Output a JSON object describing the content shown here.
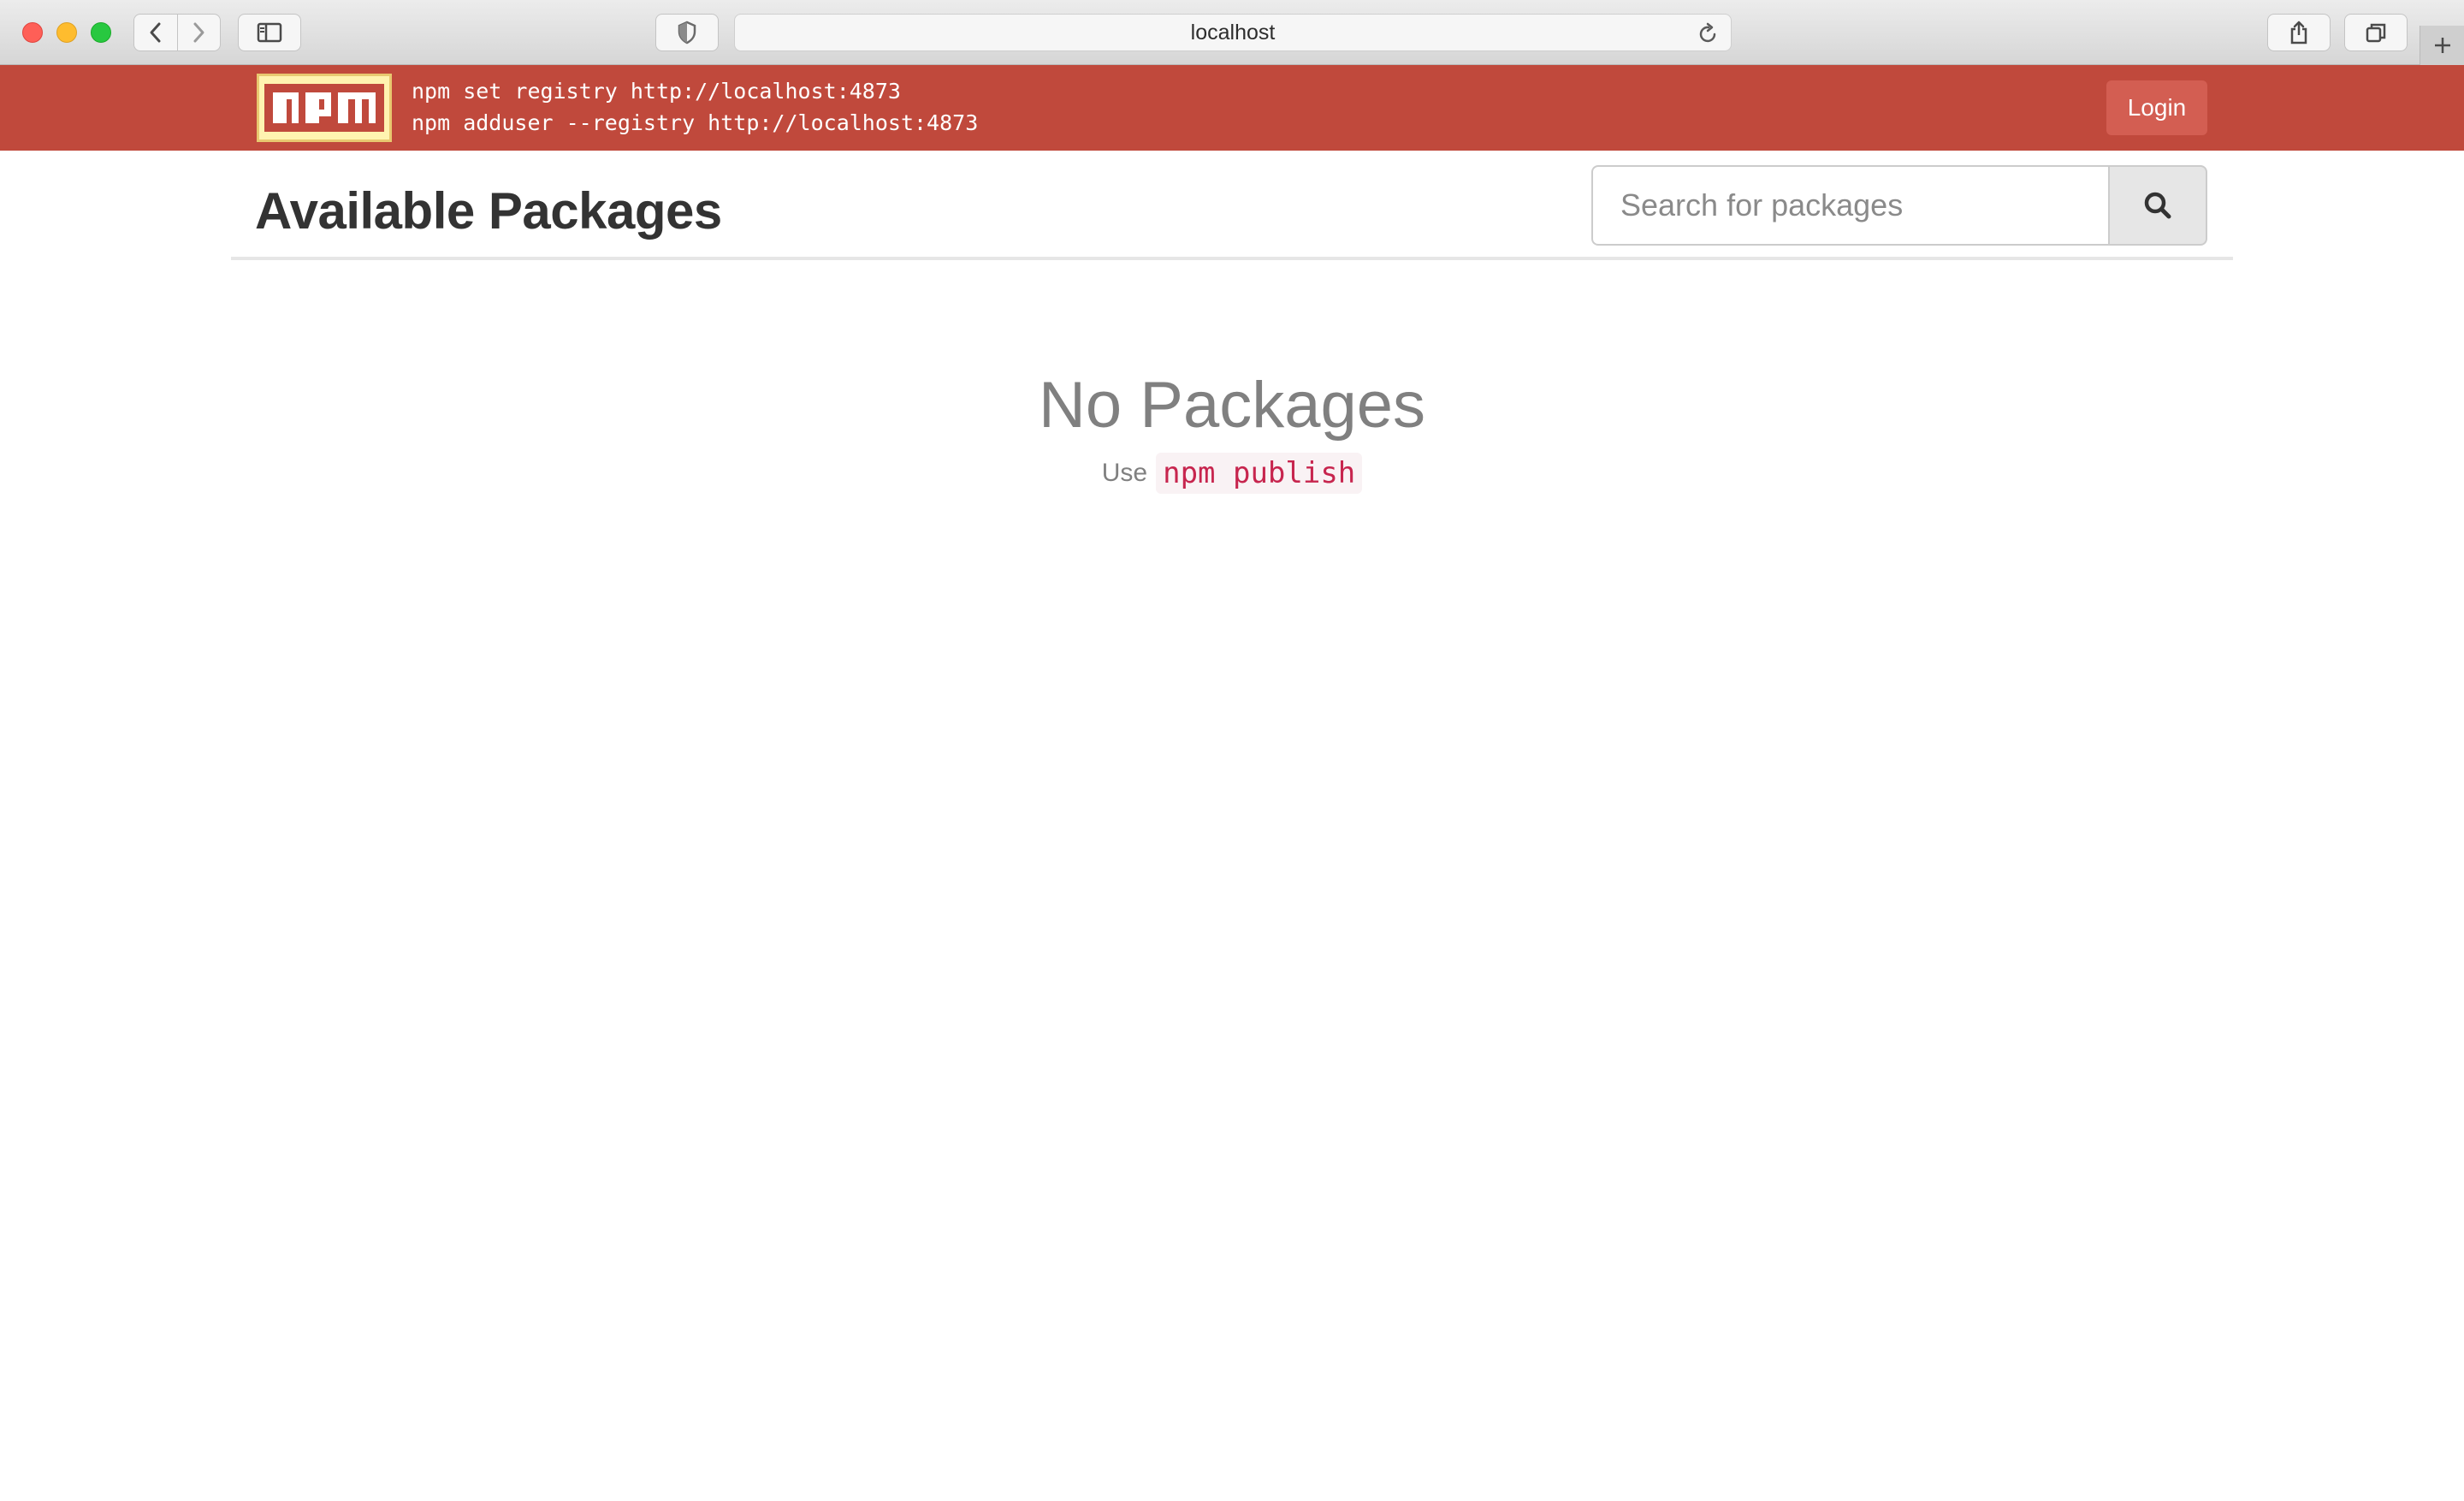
{
  "browser": {
    "address": "localhost"
  },
  "header": {
    "logo_text": "npm",
    "commands": [
      "npm set registry http://localhost:4873",
      "npm adduser --registry http://localhost:4873"
    ],
    "login_label": "Login",
    "color": "#c0493c"
  },
  "main": {
    "title": "Available Packages",
    "search": {
      "placeholder": "Search for packages",
      "value": ""
    },
    "empty": {
      "title": "No Packages",
      "hint_prefix": "Use",
      "hint_code": "npm publish"
    }
  },
  "icons": {
    "search": "magnifier-icon",
    "back": "chevron-left-icon",
    "forward": "chevron-right-icon",
    "sidebar": "sidebar-icon",
    "shield": "privacy-shield-icon",
    "reload": "reload-icon",
    "share": "share-icon",
    "tabs": "tabs-overview-icon",
    "new_tab": "plus-icon"
  }
}
